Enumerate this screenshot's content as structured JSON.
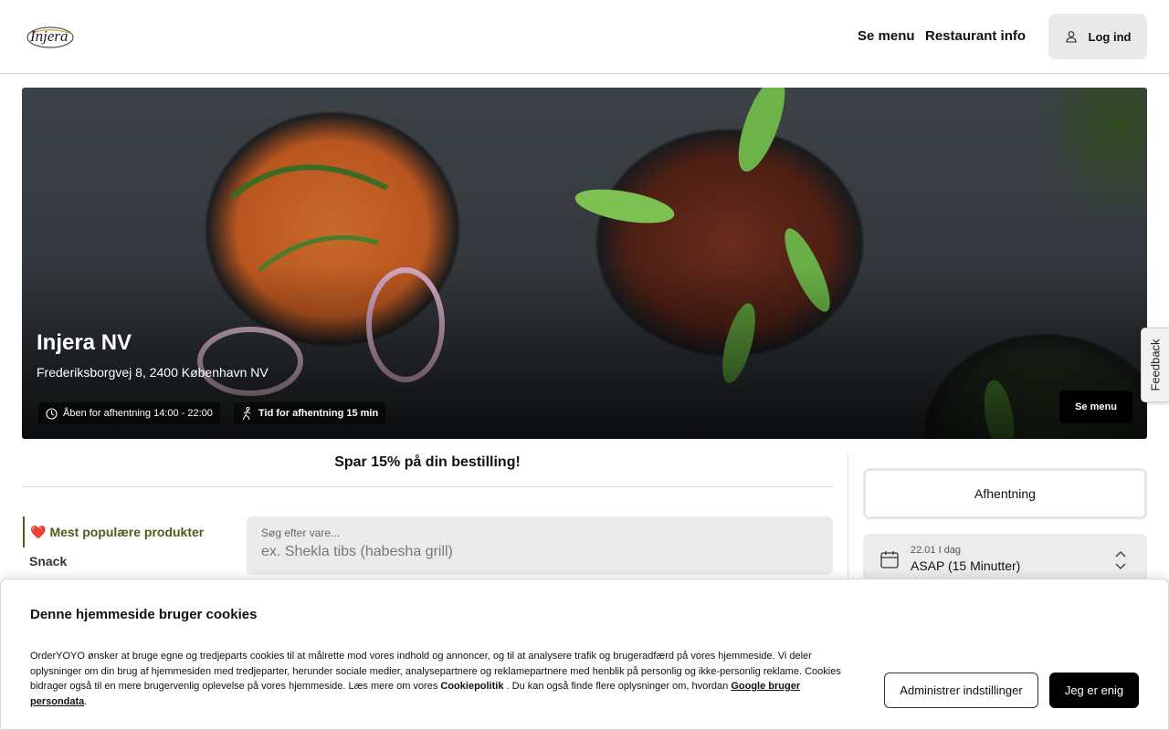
{
  "header": {
    "logo_text": "Injera",
    "nav": {
      "menu": "Se menu",
      "info": "Restaurant info"
    },
    "login_label": "Log ind"
  },
  "hero": {
    "title": "Injera NV",
    "address": "Frederiksborgvej 8, 2400 København NV",
    "open_hours": "Åben for afhentning 14:00 - 22:00",
    "pickup_time": "Tid for afhentning 15 min",
    "menu_button": "Se menu"
  },
  "feedback_label": "Feedback",
  "promo_text": "Spar 15% på din bestilling!",
  "categories": [
    {
      "icon": "❤️",
      "label": "Mest populære produkter"
    },
    {
      "label": "Snack"
    }
  ],
  "search": {
    "label": "Søg efter vare...",
    "placeholder": "ex. Shekla tibs (habesha grill)"
  },
  "order": {
    "mode": "Afhentning",
    "date": "22.01 I dag",
    "time": "ASAP (15 Minutter)"
  },
  "cookie": {
    "title": "Denne hjemmeside bruger cookies",
    "text_1": "OrderYOYO ønsker at bruge egne og tredjeparts cookies til at målrette mod vores indhold og annoncer, og til at analysere trafik og brugeradfærd på vores hjemmeside. Vi deler oplysninger om din brug af hjemmesiden med tredjeparter, herunder sociale medier, analysepartnere og reklamepartnere med henblik på personlig og ikke-personlig reklame. Cookies bidrager også til en mere brugervenlig oplevelse på vores hjemmeside. Læs mere om vores ",
    "policy_link": "Cookiepolitik",
    "text_2": " . Du kan også finde flere oplysninger om, hvordan ",
    "google_link": "Google bruger persondata",
    "text_3": ".",
    "manage_button": "Administrer indstillinger",
    "agree_button": "Jeg er enig"
  },
  "colors": {
    "accent": "#4b5d1a",
    "primary_button": "#000000"
  }
}
